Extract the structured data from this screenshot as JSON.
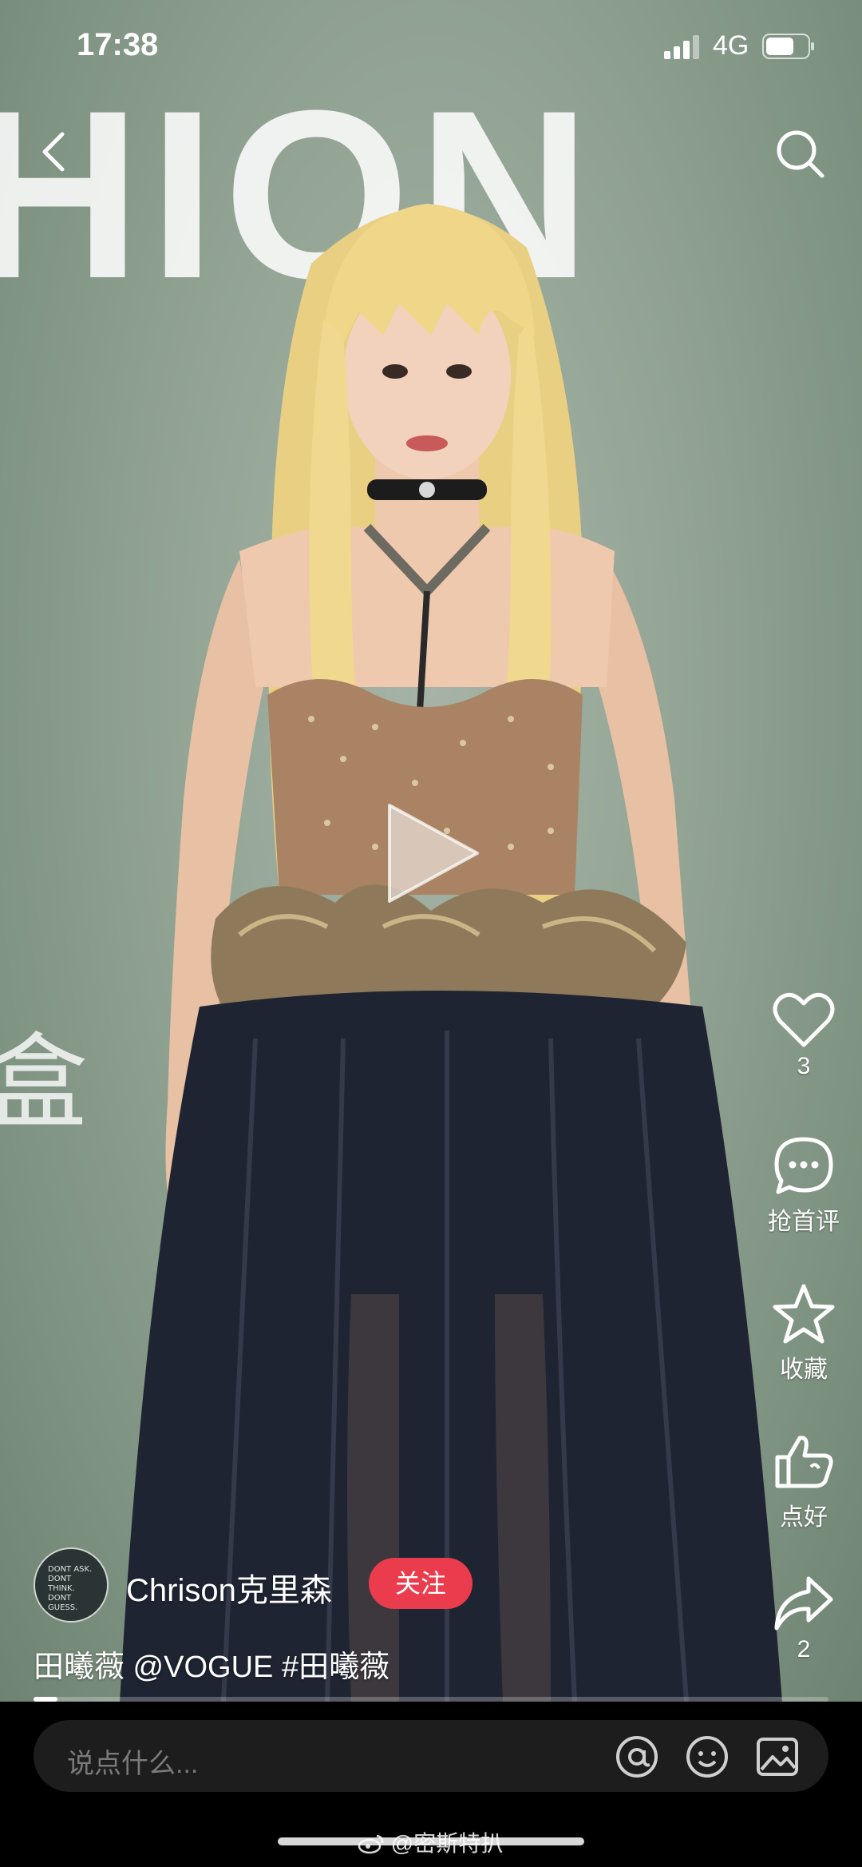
{
  "status": {
    "time": "17:38",
    "network": "4G"
  },
  "background": {
    "letters": "HION",
    "side_char": "盒"
  },
  "author": {
    "name": "Chrison克里森",
    "follow_label": "关注",
    "avatar_text": "DONT ASK. DONT THINK. DONT GUESS."
  },
  "caption": "田曦薇 @VOGUE #田曦薇",
  "actions": {
    "like_count": "3",
    "comment_label": "抢首评",
    "favorite_label": "收藏",
    "good_label": "点好",
    "share_count": "2"
  },
  "progress": {
    "percent": 3
  },
  "comment_bar": {
    "placeholder": "说点什么..."
  },
  "watermark": "@密斯特扒",
  "icons": [
    "back-icon",
    "search-icon",
    "play-icon",
    "heart-icon",
    "comment-icon",
    "star-icon",
    "thumbs-icon",
    "share-icon",
    "at-icon",
    "emoji-icon",
    "image-icon",
    "signal-icon",
    "battery-icon",
    "weibo-icon"
  ]
}
